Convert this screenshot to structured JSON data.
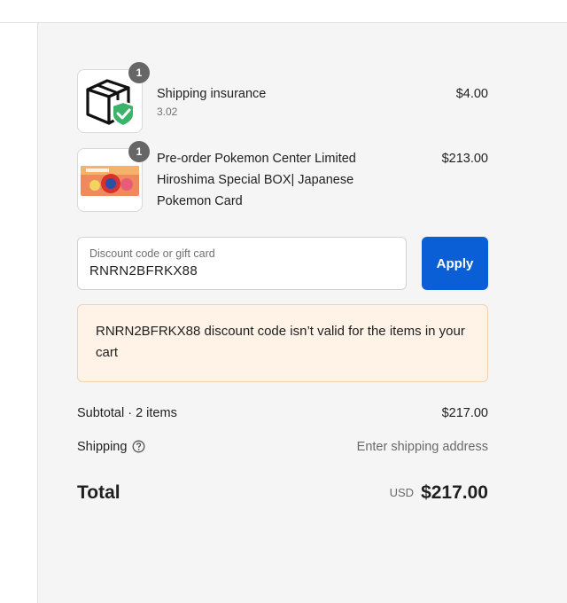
{
  "items": [
    {
      "name": "Shipping insurance",
      "subtitle": "3.02",
      "price": "$4.00",
      "quantity": "1",
      "icon": "shield-box-icon"
    },
    {
      "name": "Pre-order Pokemon Center Limited Hiroshima Special BOX| Japanese Pokemon Card",
      "subtitle": "",
      "price": "$213.00",
      "quantity": "1",
      "icon": "product-image"
    }
  ],
  "discount": {
    "label": "Discount code or gift card",
    "value": "RNRN2BFRKX88",
    "apply_label": "Apply",
    "error": "RNRN2BFRKX88 discount code isn’t valid for the items in your cart"
  },
  "totals": {
    "subtotal_label": "Subtotal · 2 items",
    "subtotal_value": "$217.00",
    "shipping_label": "Shipping",
    "shipping_value": "Enter shipping address",
    "total_label": "Total",
    "currency": "USD",
    "total_value": "$217.00"
  },
  "colors": {
    "accent": "#0b5fd6",
    "error_bg": "#fff3e8",
    "error_border": "#f5d2a8",
    "badge": "#666666",
    "check": "#3cb36b"
  }
}
